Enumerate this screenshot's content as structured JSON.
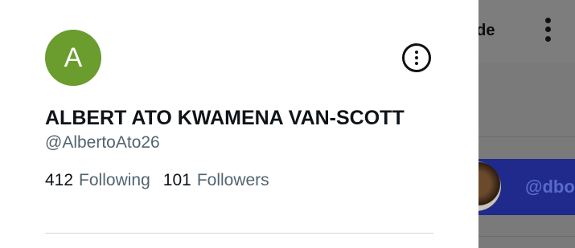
{
  "profile": {
    "avatar_letter": "A",
    "avatar_color": "#6a9c2e",
    "display_name": "ALBERT ATO KWAMENA VAN-SCOTT",
    "handle": "@AlbertoAto26",
    "following_count": "412",
    "following_label": "Following",
    "followers_count": "101",
    "followers_label": "Followers",
    "more_icon": "more-circle-icon"
  },
  "background_app": {
    "upgrade_label_partial": "ade",
    "menu_icon": "kebab-vertical-icon",
    "banner_handle_partial": "@dbo",
    "banner_color": "#1f2a8c"
  }
}
